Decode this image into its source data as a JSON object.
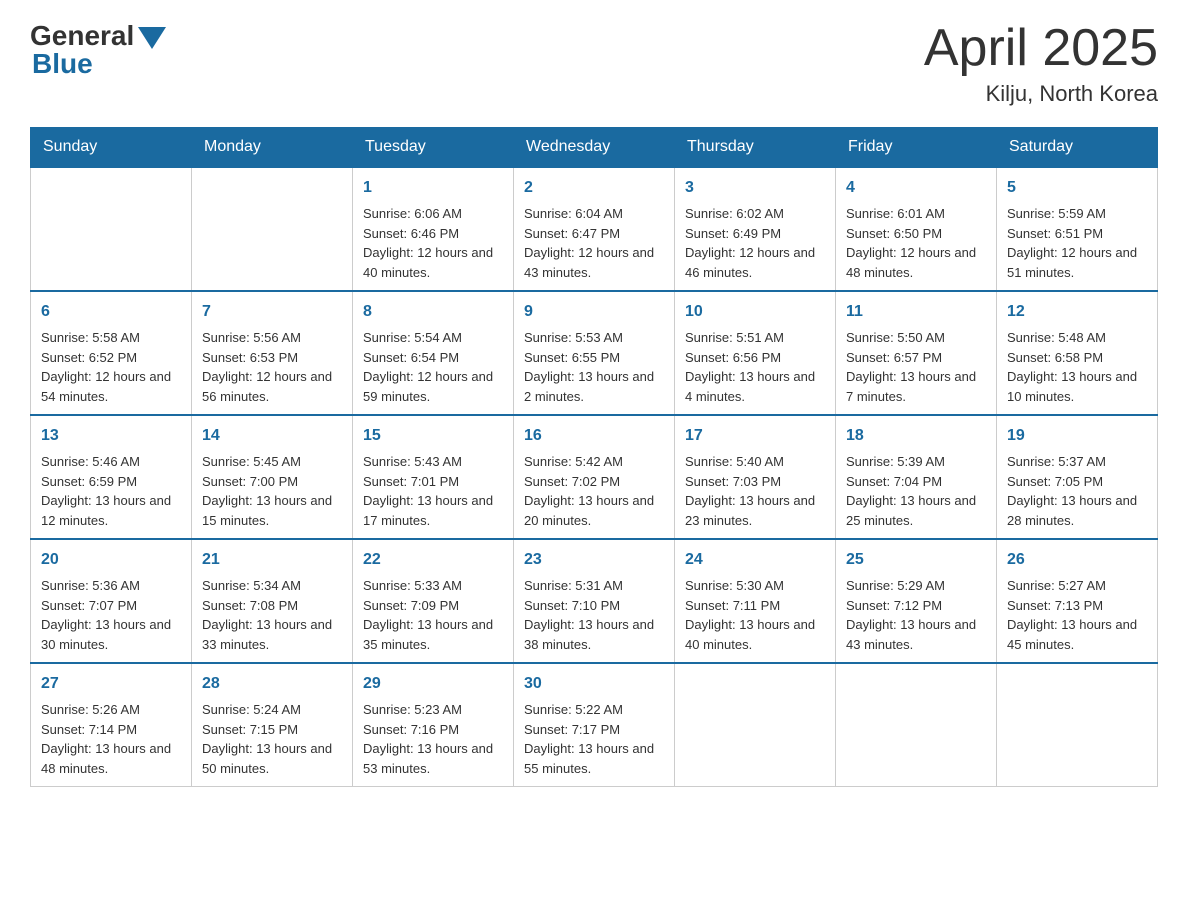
{
  "header": {
    "logo_general": "General",
    "logo_blue": "Blue",
    "title": "April 2025",
    "subtitle": "Kilju, North Korea"
  },
  "days_of_week": [
    "Sunday",
    "Monday",
    "Tuesday",
    "Wednesday",
    "Thursday",
    "Friday",
    "Saturday"
  ],
  "weeks": [
    [
      {
        "day": "",
        "sunrise": "",
        "sunset": "",
        "daylight": ""
      },
      {
        "day": "",
        "sunrise": "",
        "sunset": "",
        "daylight": ""
      },
      {
        "day": "1",
        "sunrise": "Sunrise: 6:06 AM",
        "sunset": "Sunset: 6:46 PM",
        "daylight": "Daylight: 12 hours and 40 minutes."
      },
      {
        "day": "2",
        "sunrise": "Sunrise: 6:04 AM",
        "sunset": "Sunset: 6:47 PM",
        "daylight": "Daylight: 12 hours and 43 minutes."
      },
      {
        "day": "3",
        "sunrise": "Sunrise: 6:02 AM",
        "sunset": "Sunset: 6:49 PM",
        "daylight": "Daylight: 12 hours and 46 minutes."
      },
      {
        "day": "4",
        "sunrise": "Sunrise: 6:01 AM",
        "sunset": "Sunset: 6:50 PM",
        "daylight": "Daylight: 12 hours and 48 minutes."
      },
      {
        "day": "5",
        "sunrise": "Sunrise: 5:59 AM",
        "sunset": "Sunset: 6:51 PM",
        "daylight": "Daylight: 12 hours and 51 minutes."
      }
    ],
    [
      {
        "day": "6",
        "sunrise": "Sunrise: 5:58 AM",
        "sunset": "Sunset: 6:52 PM",
        "daylight": "Daylight: 12 hours and 54 minutes."
      },
      {
        "day": "7",
        "sunrise": "Sunrise: 5:56 AM",
        "sunset": "Sunset: 6:53 PM",
        "daylight": "Daylight: 12 hours and 56 minutes."
      },
      {
        "day": "8",
        "sunrise": "Sunrise: 5:54 AM",
        "sunset": "Sunset: 6:54 PM",
        "daylight": "Daylight: 12 hours and 59 minutes."
      },
      {
        "day": "9",
        "sunrise": "Sunrise: 5:53 AM",
        "sunset": "Sunset: 6:55 PM",
        "daylight": "Daylight: 13 hours and 2 minutes."
      },
      {
        "day": "10",
        "sunrise": "Sunrise: 5:51 AM",
        "sunset": "Sunset: 6:56 PM",
        "daylight": "Daylight: 13 hours and 4 minutes."
      },
      {
        "day": "11",
        "sunrise": "Sunrise: 5:50 AM",
        "sunset": "Sunset: 6:57 PM",
        "daylight": "Daylight: 13 hours and 7 minutes."
      },
      {
        "day": "12",
        "sunrise": "Sunrise: 5:48 AM",
        "sunset": "Sunset: 6:58 PM",
        "daylight": "Daylight: 13 hours and 10 minutes."
      }
    ],
    [
      {
        "day": "13",
        "sunrise": "Sunrise: 5:46 AM",
        "sunset": "Sunset: 6:59 PM",
        "daylight": "Daylight: 13 hours and 12 minutes."
      },
      {
        "day": "14",
        "sunrise": "Sunrise: 5:45 AM",
        "sunset": "Sunset: 7:00 PM",
        "daylight": "Daylight: 13 hours and 15 minutes."
      },
      {
        "day": "15",
        "sunrise": "Sunrise: 5:43 AM",
        "sunset": "Sunset: 7:01 PM",
        "daylight": "Daylight: 13 hours and 17 minutes."
      },
      {
        "day": "16",
        "sunrise": "Sunrise: 5:42 AM",
        "sunset": "Sunset: 7:02 PM",
        "daylight": "Daylight: 13 hours and 20 minutes."
      },
      {
        "day": "17",
        "sunrise": "Sunrise: 5:40 AM",
        "sunset": "Sunset: 7:03 PM",
        "daylight": "Daylight: 13 hours and 23 minutes."
      },
      {
        "day": "18",
        "sunrise": "Sunrise: 5:39 AM",
        "sunset": "Sunset: 7:04 PM",
        "daylight": "Daylight: 13 hours and 25 minutes."
      },
      {
        "day": "19",
        "sunrise": "Sunrise: 5:37 AM",
        "sunset": "Sunset: 7:05 PM",
        "daylight": "Daylight: 13 hours and 28 minutes."
      }
    ],
    [
      {
        "day": "20",
        "sunrise": "Sunrise: 5:36 AM",
        "sunset": "Sunset: 7:07 PM",
        "daylight": "Daylight: 13 hours and 30 minutes."
      },
      {
        "day": "21",
        "sunrise": "Sunrise: 5:34 AM",
        "sunset": "Sunset: 7:08 PM",
        "daylight": "Daylight: 13 hours and 33 minutes."
      },
      {
        "day": "22",
        "sunrise": "Sunrise: 5:33 AM",
        "sunset": "Sunset: 7:09 PM",
        "daylight": "Daylight: 13 hours and 35 minutes."
      },
      {
        "day": "23",
        "sunrise": "Sunrise: 5:31 AM",
        "sunset": "Sunset: 7:10 PM",
        "daylight": "Daylight: 13 hours and 38 minutes."
      },
      {
        "day": "24",
        "sunrise": "Sunrise: 5:30 AM",
        "sunset": "Sunset: 7:11 PM",
        "daylight": "Daylight: 13 hours and 40 minutes."
      },
      {
        "day": "25",
        "sunrise": "Sunrise: 5:29 AM",
        "sunset": "Sunset: 7:12 PM",
        "daylight": "Daylight: 13 hours and 43 minutes."
      },
      {
        "day": "26",
        "sunrise": "Sunrise: 5:27 AM",
        "sunset": "Sunset: 7:13 PM",
        "daylight": "Daylight: 13 hours and 45 minutes."
      }
    ],
    [
      {
        "day": "27",
        "sunrise": "Sunrise: 5:26 AM",
        "sunset": "Sunset: 7:14 PM",
        "daylight": "Daylight: 13 hours and 48 minutes."
      },
      {
        "day": "28",
        "sunrise": "Sunrise: 5:24 AM",
        "sunset": "Sunset: 7:15 PM",
        "daylight": "Daylight: 13 hours and 50 minutes."
      },
      {
        "day": "29",
        "sunrise": "Sunrise: 5:23 AM",
        "sunset": "Sunset: 7:16 PM",
        "daylight": "Daylight: 13 hours and 53 minutes."
      },
      {
        "day": "30",
        "sunrise": "Sunrise: 5:22 AM",
        "sunset": "Sunset: 7:17 PM",
        "daylight": "Daylight: 13 hours and 55 minutes."
      },
      {
        "day": "",
        "sunrise": "",
        "sunset": "",
        "daylight": ""
      },
      {
        "day": "",
        "sunrise": "",
        "sunset": "",
        "daylight": ""
      },
      {
        "day": "",
        "sunrise": "",
        "sunset": "",
        "daylight": ""
      }
    ]
  ]
}
